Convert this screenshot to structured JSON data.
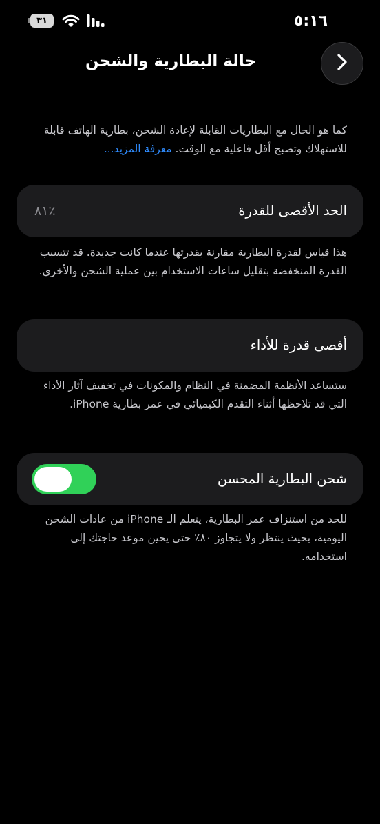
{
  "status_bar": {
    "time": "٥:١٦",
    "battery_level": "٣١"
  },
  "header": {
    "title": "حالة البطارية والشحن"
  },
  "intro": {
    "text": "كما هو الحال مع البطاريات القابلة لإعادة الشحن، بطارية الهاتف قابلة للاستهلاك وتصبح أقل فاعلية مع الوقت.",
    "link_label": "معرفة المزيد..."
  },
  "max_capacity": {
    "label": "الحد الأقصى للقدرة",
    "value": "٨١٪",
    "note": "هذا قياس لقدرة البطارية مقارنة بقدرتها عندما كانت جديدة. قد تتسبب القدرة المنخفضة بتقليل ساعات الاستخدام بين عملية الشحن والأخرى."
  },
  "peak_performance": {
    "label": "أقصى قدرة للأداء",
    "note": "ستساعد الأنظمة المضمنة في النظام والمكونات في تخفيف آثار الأداء التي قد تلاحظها أثناء التقدم الكيميائي في عمر بطارية iPhone."
  },
  "optimized_charging": {
    "label": "شحن البطارية المحسن",
    "enabled": true,
    "note": "للحد من استنزاف عمر البطارية، يتعلم الـ iPhone من عادات الشحن اليومية، بحيث ينتظر ولا يتجاوز ٨٠٪ حتى يحين موعد حاجتك إلى استخدامه."
  },
  "colors": {
    "background": "#000000",
    "cell": "#1c1c1e",
    "accent_link": "#2f8cff",
    "toggle_on": "#30d158"
  }
}
